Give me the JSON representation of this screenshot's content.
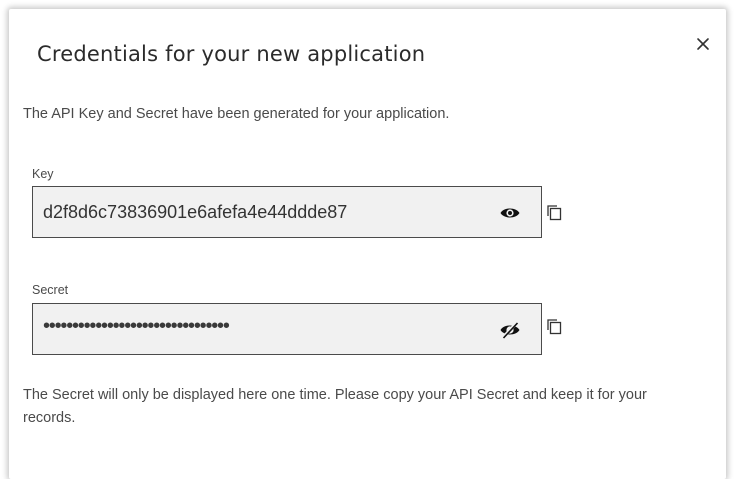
{
  "dialog": {
    "title": "Credentials for your new application",
    "close_icon": "close-icon",
    "subtitle": "The API Key and Secret have been generated for your application.",
    "footer_note": "The Secret will only be displayed here one time. Please copy your API Secret and keep it for your records."
  },
  "key_field": {
    "label": "Key",
    "value": "d2f8d6c73836901e6afefa4e44ddde87",
    "visibility_icon": "eye-icon",
    "copy_icon": "copy-icon"
  },
  "secret_field": {
    "label": "Secret",
    "value": "••••••••••••••••••••••••••••••••",
    "visibility_icon": "eye-slash-icon",
    "copy_icon": "copy-icon"
  },
  "colors": {
    "field_background": "#f1f1f1",
    "field_border": "#4b4b4b",
    "text": "#4a4a4a",
    "title": "#2b2b2b"
  }
}
